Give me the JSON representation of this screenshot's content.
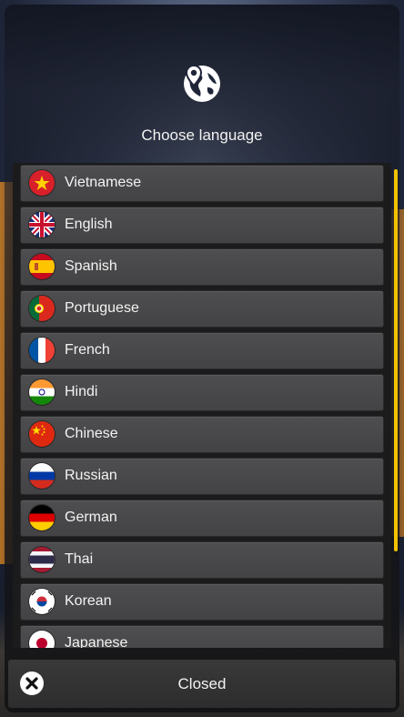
{
  "header": {
    "icon": "globe-location-icon",
    "title": "Choose language"
  },
  "languages": [
    {
      "label": "Vietnamese",
      "flag": "vietnam-flag-icon"
    },
    {
      "label": "English",
      "flag": "uk-flag-icon"
    },
    {
      "label": "Spanish",
      "flag": "spain-flag-icon"
    },
    {
      "label": "Portuguese",
      "flag": "portugal-flag-icon"
    },
    {
      "label": "French",
      "flag": "france-flag-icon"
    },
    {
      "label": "Hindi",
      "flag": "india-flag-icon"
    },
    {
      "label": "Chinese",
      "flag": "china-flag-icon"
    },
    {
      "label": "Russian",
      "flag": "russia-flag-icon"
    },
    {
      "label": "German",
      "flag": "germany-flag-icon"
    },
    {
      "label": "Thai",
      "flag": "thailand-flag-icon"
    },
    {
      "label": "Korean",
      "flag": "korea-flag-icon"
    },
    {
      "label": "Japanese",
      "flag": "japan-flag-icon"
    }
  ],
  "footer": {
    "close_icon": "close-x-icon",
    "close_label": "Closed"
  },
  "colors": {
    "scrollbar": "#f2c200",
    "row_bg": "#4a4a4c"
  }
}
